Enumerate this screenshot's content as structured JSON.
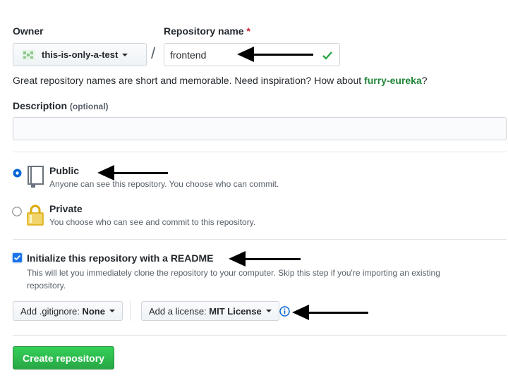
{
  "owner": {
    "label": "Owner",
    "value": "this-is-only-a-test"
  },
  "separator": "/",
  "repo": {
    "label": "Repository name",
    "required_mark": "*",
    "value": "frontend"
  },
  "hint": {
    "prefix": "Great repository names are short and memorable. Need inspiration? How about ",
    "suggestion": "furry-eureka",
    "suffix": "?"
  },
  "description": {
    "label": "Description",
    "optional": "(optional)",
    "value": ""
  },
  "visibility": {
    "selected": "public",
    "public": {
      "title": "Public",
      "desc": "Anyone can see this repository. You choose who can commit."
    },
    "private": {
      "title": "Private",
      "desc": "You choose who can see and commit to this repository."
    }
  },
  "readme": {
    "checked": true,
    "title": "Initialize this repository with a README",
    "desc": "This will let you immediately clone the repository to your computer. Skip this step if you're importing an existing repository."
  },
  "gitignore": {
    "prefix": "Add .gitignore:",
    "value": "None"
  },
  "license": {
    "prefix": "Add a license:",
    "value": "MIT License"
  },
  "create_button": "Create repository",
  "colors": {
    "primary_green": "#2ea44f",
    "link_green": "#22863a",
    "info_blue": "#0366d6",
    "required_red": "#cb2431",
    "check_green": "#28a745"
  },
  "icons": [
    "identicon",
    "check-icon",
    "repo-book-icon",
    "lock-icon",
    "info-icon",
    "arrow-annotation"
  ]
}
